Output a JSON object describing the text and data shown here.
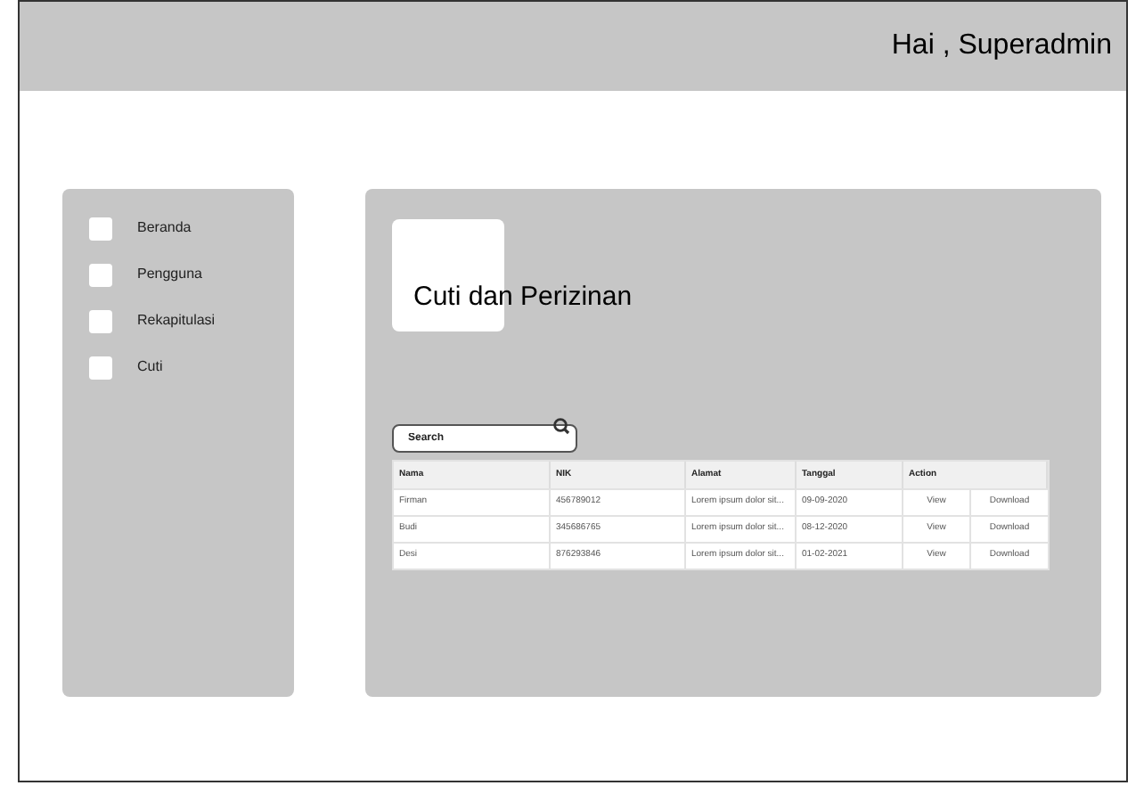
{
  "header": {
    "greeting": "Hai , Superadmin"
  },
  "sidebar": {
    "items": [
      {
        "label": "Beranda"
      },
      {
        "label": "Pengguna"
      },
      {
        "label": "Rekapitulasi"
      },
      {
        "label": "Cuti"
      }
    ]
  },
  "main": {
    "title": "Cuti dan Perizinan",
    "search": {
      "placeholder": "Search"
    },
    "table": {
      "columns": [
        "Nama",
        "NIK",
        "Alamat",
        "Tanggal",
        "Action"
      ],
      "rows": [
        {
          "cells": [
            "Firman",
            "456789012",
            "Lorem ipsum dolor sit...",
            "09-09-2020"
          ],
          "actions": [
            "View",
            "Download"
          ]
        },
        {
          "cells": [
            "Budi",
            "345686765",
            "Lorem ipsum dolor sit...",
            "08-12-2020"
          ],
          "actions": [
            "View",
            "Download"
          ]
        },
        {
          "cells": [
            "Desi",
            "876293846",
            "Lorem ipsum dolor sit...",
            "01-02-2021"
          ],
          "actions": [
            "View",
            "Download"
          ]
        }
      ]
    }
  }
}
